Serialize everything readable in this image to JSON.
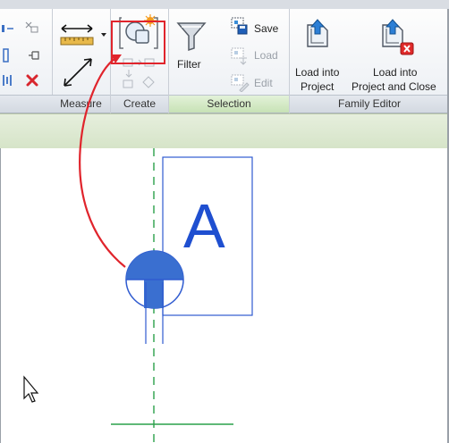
{
  "ribbon": {
    "selection_buttons": {
      "save": "Save",
      "load": "Load",
      "edit": "Edit"
    },
    "filter": "Filter",
    "family_editor": {
      "load_into_project": [
        "Load into",
        "Project"
      ],
      "load_and_close": [
        "Load into",
        "Project and Close"
      ]
    },
    "panels": {
      "measure": "Measure",
      "create": "Create",
      "selection": "Selection",
      "family_editor": "Family Editor"
    }
  },
  "canvas": {
    "section_tag_letter": "A"
  },
  "colors": {
    "annotation_blue": "#2f5bd0",
    "callout_red": "#e0242c",
    "reference_green": "#2aa04a",
    "active_panel": "#c7e2b5"
  }
}
